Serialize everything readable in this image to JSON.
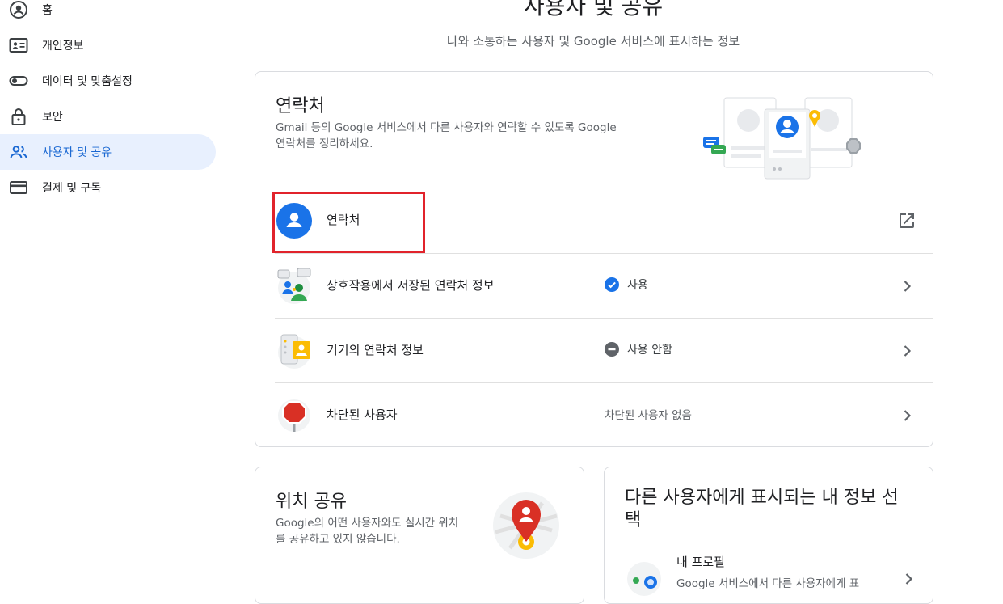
{
  "sidebar": {
    "items": [
      {
        "label": "홈",
        "icon": "home-account-icon"
      },
      {
        "label": "개인정보",
        "icon": "id-card-icon"
      },
      {
        "label": "데이터 및 맞춤설정",
        "icon": "toggle-icon"
      },
      {
        "label": "보안",
        "icon": "lock-icon"
      },
      {
        "label": "사용자 및 공유",
        "icon": "people-icon",
        "active": true
      },
      {
        "label": "결제 및 구독",
        "icon": "credit-card-icon"
      }
    ]
  },
  "header": {
    "title": "사용자 및 공유",
    "subtitle": "나와 소통하는 사용자 및 Google 서비스에 표시하는 정보"
  },
  "contacts_card": {
    "title": "연락처",
    "description_line1": "Gmail 등의 Google 서비스에서 다른 사용자와 연락할 수 있도록 Google",
    "description_line2": "연락처를 정리하세요.",
    "rows": [
      {
        "label": "연락처",
        "status": "",
        "action": "open-in-new-icon"
      },
      {
        "label": "상호작용에서 저장된 연락처 정보",
        "status": "사용",
        "status_icon": "check-circle-icon",
        "action": "chevron-right-icon"
      },
      {
        "label": "기기의 연락처 정보",
        "status": "사용 안함",
        "status_icon": "minus-circle-icon",
        "action": "chevron-right-icon"
      },
      {
        "label": "차단된 사용자",
        "status": "차단된 사용자 없음",
        "action": "chevron-right-icon"
      }
    ]
  },
  "location_card": {
    "title": "위치 공유",
    "description_line1": "Google의 어떤 사용자와도 실시간 위치",
    "description_line2": "를 공유하고 있지 않습니다."
  },
  "profile_card": {
    "title_line1": "다른 사용자에게 표시되는 내 정보 선",
    "title_line2": "택",
    "row_label": "내 프로필",
    "row_desc": "Google 서비스에서 다른 사용자에게 표"
  },
  "colors": {
    "accent_blue": "#1a73e8",
    "active_nav_bg": "#e8f0fe",
    "highlight_red": "#e1232b"
  }
}
